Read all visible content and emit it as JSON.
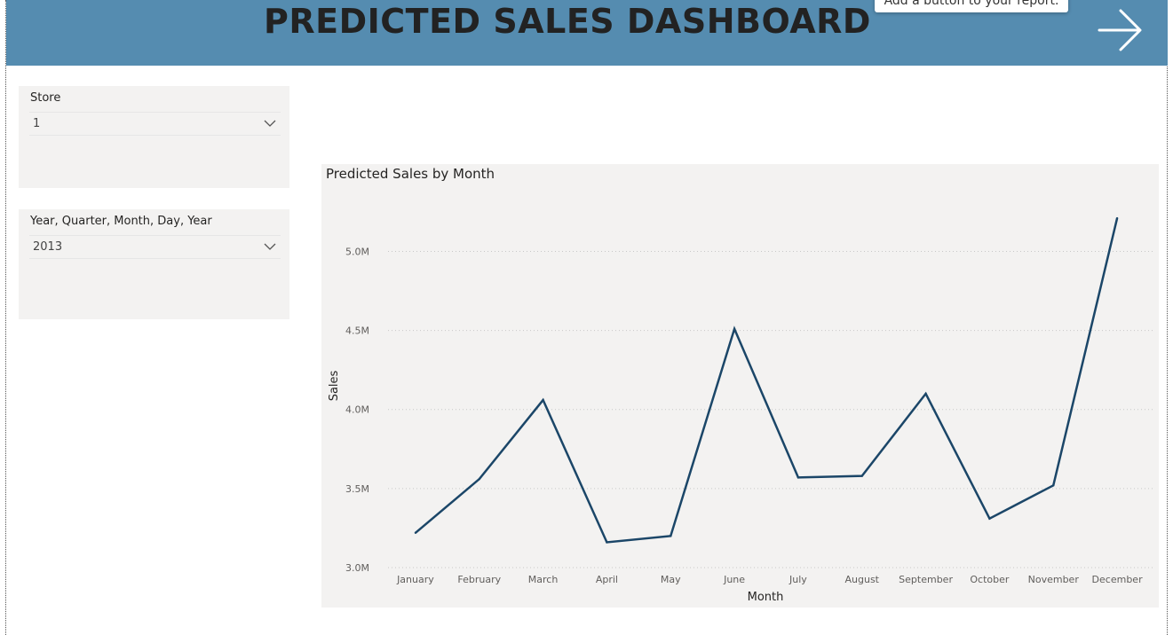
{
  "header": {
    "title": "PREDICTED SALES DASHBOARD",
    "tooltip": "Add a button to your report.",
    "bg_color": "#558cb0",
    "arrow_icon": "arrow-right-icon"
  },
  "slicers": [
    {
      "title": "Store",
      "value": "1"
    },
    {
      "title": "Year, Quarter, Month, Day, Year",
      "value": "2013"
    }
  ],
  "chart_data": {
    "type": "line",
    "title": "Predicted Sales by Month",
    "xlabel": "Month",
    "ylabel": "Sales",
    "categories": [
      "January",
      "February",
      "March",
      "April",
      "May",
      "June",
      "July",
      "August",
      "September",
      "October",
      "November",
      "December"
    ],
    "series": [
      {
        "values": [
          3.22,
          3.56,
          4.06,
          3.16,
          3.2,
          4.51,
          3.57,
          3.58,
          4.1,
          3.31,
          3.52,
          5.21
        ]
      }
    ],
    "ylim": [
      3.0,
      5.3
    ],
    "yticks": [
      3.0,
      3.5,
      4.0,
      4.5,
      5.0
    ],
    "ytick_labels": [
      "3.0M",
      "3.5M",
      "4.0M",
      "4.5M",
      "5.0M"
    ],
    "grid": true,
    "line_color": "#1b4668"
  }
}
